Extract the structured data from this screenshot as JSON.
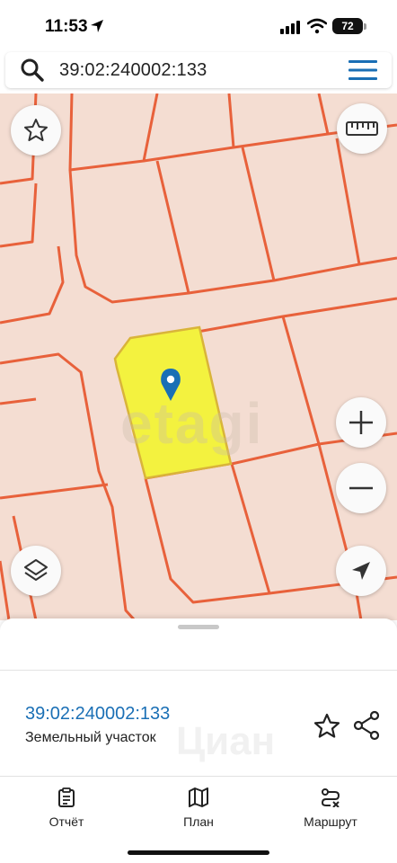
{
  "status_bar": {
    "time": "11:53",
    "battery": "72"
  },
  "search": {
    "query": "39:02:240002:133"
  },
  "map": {
    "watermark": "etagi",
    "parcel_color": "#e8613b",
    "selected_parcel_fill": "#f3f23f",
    "background": "#f4ddd2",
    "pin_color": "#1a6fb5",
    "controls": [
      "star-icon",
      "ruler-icon",
      "zoom-in-icon",
      "zoom-out-icon",
      "layers-icon",
      "navigation-arrow-icon"
    ]
  },
  "sheet": {
    "cadastral_number": "39:02:240002:133",
    "object_type": "Земельный участок",
    "watermark": "Циан"
  },
  "tabs": [
    {
      "label": "Отчёт",
      "icon": "report-clipboard-icon"
    },
    {
      "label": "План",
      "icon": "map-plan-icon"
    },
    {
      "label": "Маршрут",
      "icon": "route-icon"
    }
  ]
}
